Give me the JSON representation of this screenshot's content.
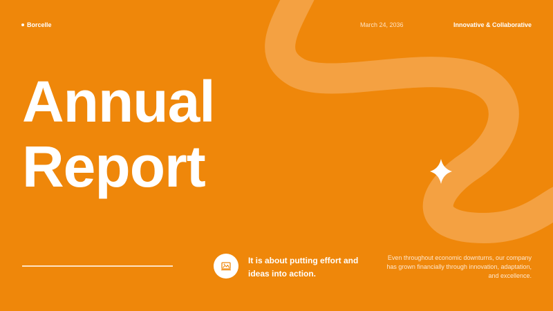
{
  "header": {
    "brand": "Borcelle",
    "date": "March 24, 2036",
    "tagline": "Innovative & Collaborative"
  },
  "title": {
    "line1": "Annual",
    "line2": "Report"
  },
  "quote": "It is about putting effort and ideas into action.",
  "blurb": "Even throughout economic downturns, our company has grown financially through innovation, adaptation, and excellence.",
  "icons": {
    "feature": "image-icon",
    "decoration": "sparkle-icon"
  },
  "colors": {
    "background": "#EF870A",
    "wave": "#F4A142",
    "text": "#FFFFFF"
  }
}
